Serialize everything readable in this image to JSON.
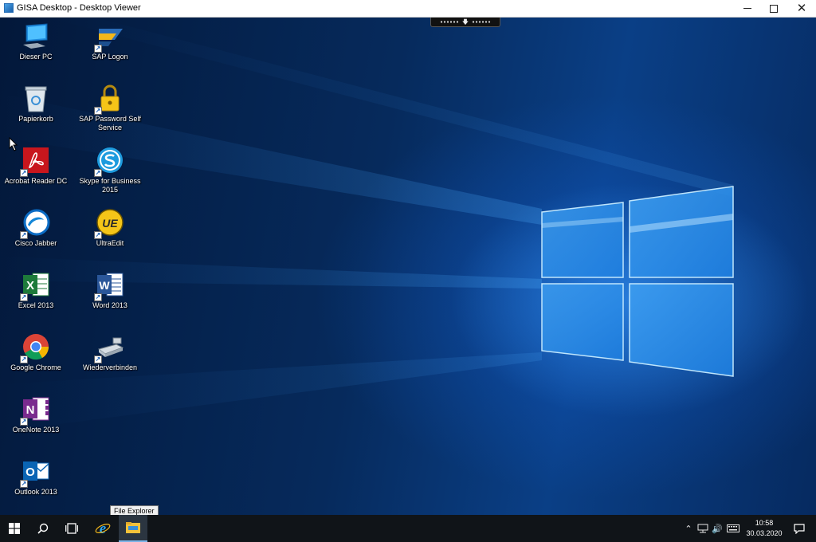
{
  "window": {
    "title": "GISA Desktop - Desktop Viewer",
    "controls": [
      "minimize",
      "maximize",
      "close"
    ],
    "close_glyph": "✕"
  },
  "desktop": {
    "icons": [
      {
        "label": "Dieser PC",
        "icon": "computer-icon"
      },
      {
        "label": "Papierkorb",
        "icon": "recycle-bin-icon"
      },
      {
        "label": "Acrobat Reader DC",
        "icon": "acrobat-icon"
      },
      {
        "label": "Cisco Jabber",
        "icon": "jabber-icon"
      },
      {
        "label": "Excel 2013",
        "icon": "excel-icon"
      },
      {
        "label": "Google Chrome",
        "icon": "chrome-icon"
      },
      {
        "label": "OneNote 2013",
        "icon": "onenote-icon"
      },
      {
        "label": "Outlook 2013",
        "icon": "outlook-icon"
      },
      {
        "label": "SAP Logon",
        "icon": "sap-logon-icon"
      },
      {
        "label": "SAP Password Self Service",
        "icon": "lock-icon"
      },
      {
        "label": "Skype for Business 2015",
        "icon": "skype-icon"
      },
      {
        "label": "UltraEdit",
        "icon": "ultraedit-icon"
      },
      {
        "label": "Word 2013",
        "icon": "word-icon"
      },
      {
        "label": "Wiederverbinden",
        "icon": "reconnect-icon"
      }
    ],
    "glyphs": {
      "excel": "X",
      "onenote": "N",
      "outlook": "O",
      "word": "W",
      "ultraedit": "UE",
      "shortcut": "↗",
      "conn_arrow": "🡇"
    }
  },
  "taskbar": {
    "tooltip": "File Explorer",
    "pinned": [
      "start-icon",
      "search-icon",
      "task-view-icon",
      "internet-explorer-icon",
      "file-explorer-icon"
    ],
    "tray": {
      "chevron": "⌃",
      "volume": "🔊",
      "time": "10:58",
      "date": "30.03.2020"
    }
  },
  "colors": {
    "accent": "#0078d7",
    "taskbar": "#101418",
    "wallpaper_glow": "#3aa0ff"
  }
}
